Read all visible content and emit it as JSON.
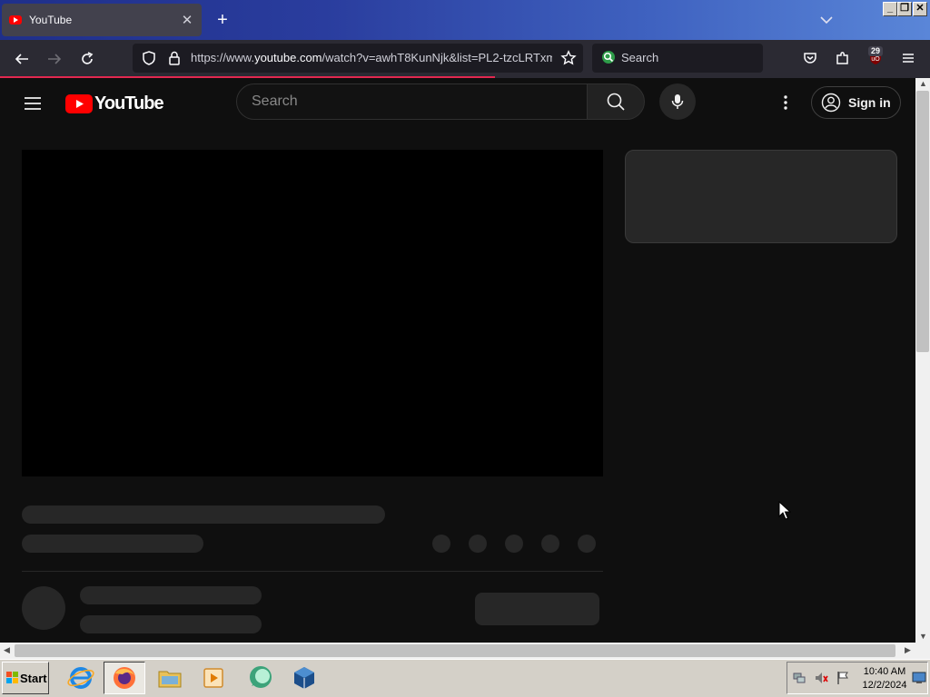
{
  "browser": {
    "tab": {
      "title": "YouTube",
      "close_glyph": "✕"
    },
    "new_tab_glyph": "+",
    "url": {
      "prefix": "https://www.",
      "host": "youtube.com",
      "path": "/watch?v=awhT8KunNjk&list=PL2-tzcLRTxm"
    },
    "search_placeholder": "Search",
    "extensions_badge": "29",
    "window_controls": {
      "minimize": "_",
      "restore": "❐",
      "close": "✕"
    },
    "colors": {
      "tab_bg": "#42414d",
      "toolbar_bg": "#2b2a33",
      "progress": "#e22850"
    }
  },
  "youtube": {
    "logo_text": "YouTube",
    "search_placeholder": "Search",
    "sign_in_label": "Sign in",
    "colors": {
      "brand_red": "#ff0000",
      "bg": "#0f0f0f",
      "skeleton": "#272727"
    }
  },
  "taskbar": {
    "start_label": "Start",
    "clock": {
      "time": "10:40 AM",
      "date": "12/2/2024"
    }
  }
}
